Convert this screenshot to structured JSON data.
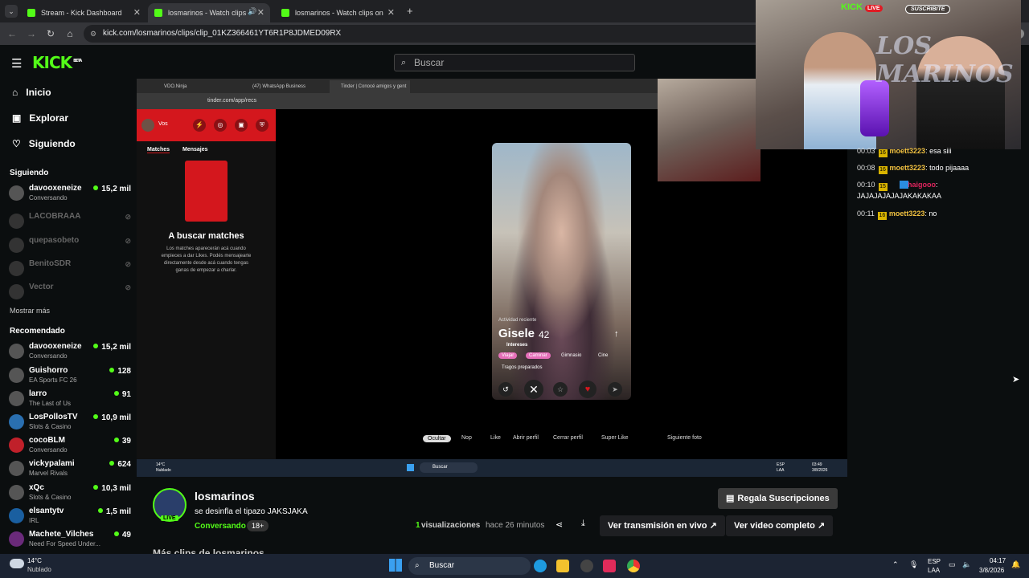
{
  "browser": {
    "tabs": [
      {
        "label": "Stream - Kick Dashboard"
      },
      {
        "label": "losmarinos - Watch clips on"
      },
      {
        "label": "losmarinos - Watch clips on Kic"
      }
    ],
    "url": "kick.com/losmarinos/clips/clip_01KZ366461YT6R1P8JDMED09RX"
  },
  "header": {
    "logo": "KICK",
    "logo_badge": "BETA",
    "search_placeholder": "Buscar"
  },
  "sidebar": {
    "nav": [
      {
        "label": "Inicio",
        "icon": "home-icon"
      },
      {
        "label": "Explorar",
        "icon": "compass-icon"
      },
      {
        "label": "Siguiendo",
        "icon": "heart-icon"
      }
    ],
    "following_title": "Siguiendo",
    "following": [
      {
        "name": "davooxeneize",
        "sub": "Conversando",
        "viewers": "15,2 mil",
        "live": true
      },
      {
        "name": "LACOBRAAA",
        "sub": "",
        "viewers": "",
        "live": false
      },
      {
        "name": "quepasobeto",
        "sub": "",
        "viewers": "",
        "live": false
      },
      {
        "name": "BenitoSDR",
        "sub": "",
        "viewers": "",
        "live": false
      },
      {
        "name": "Vector",
        "sub": "",
        "viewers": "",
        "live": false
      }
    ],
    "show_more": "Mostrar más",
    "recommended_title": "Recomendado",
    "recommended": [
      {
        "name": "davooxeneize",
        "sub": "Conversando",
        "viewers": "15,2 mil"
      },
      {
        "name": "Guishorro",
        "sub": "EA Sports FC 26",
        "viewers": "128"
      },
      {
        "name": "larro",
        "sub": "The Last of Us",
        "viewers": "91"
      },
      {
        "name": "LosPollosTV",
        "sub": "Slots & Casino",
        "viewers": "10,9 mil"
      },
      {
        "name": "cocoBLM",
        "sub": "Conversando",
        "viewers": "39"
      },
      {
        "name": "vickypalami",
        "sub": "Marvel Rivals",
        "viewers": "624"
      },
      {
        "name": "xQc",
        "sub": "Slots & Casino",
        "viewers": "10,3 mil"
      },
      {
        "name": "elsantytv",
        "sub": "IRL",
        "viewers": "1,5 mil"
      },
      {
        "name": "Machete_Vilches",
        "sub": "Need For Speed Under...",
        "viewers": "49"
      }
    ]
  },
  "embedded": {
    "tabs": [
      "VDO.Ninja",
      "(47) WhatsApp Business",
      "Tinder | Conocé amigos y gent"
    ],
    "url": "tinder.com/app/recs",
    "panel": {
      "user": "Vos",
      "tab_matches": "Matches",
      "tab_messages": "Mensajes",
      "empty_title": "A buscar matches",
      "empty_text": "Los matches aparecerán acá cuando empieces a dar Likes. Podés mensajearte directamente desde acá cuando tengas ganas de empezar a charlar."
    },
    "profile": {
      "activity": "Actividad reciente",
      "name": "Gisele",
      "age": "42",
      "interests_title": "Intereses",
      "interests": [
        "Viajar",
        "Caminar",
        "Gimnasio",
        "Cine",
        "Tragos preparados"
      ]
    },
    "hints": [
      "Ocultar",
      "Nop",
      "Like",
      "Abrir perfil",
      "Cerrar perfil",
      "Super Like",
      "Siguiente foto"
    ],
    "taskbar": {
      "weather_temp": "14°C",
      "weather_desc": "Nublado",
      "search": "Buscar",
      "lang": "ESP",
      "region": "LAA",
      "time": "03:49",
      "date": "3/8/2026"
    }
  },
  "overlay": {
    "brand": "KICK",
    "live": "LIVE",
    "subscribe": "SUSCRIBITE",
    "banner": "LOS MARINOS"
  },
  "chat": [
    {
      "time": "00:03",
      "badge": "16",
      "user": "moett3223",
      "text": ": esa siii",
      "color": "#f0c040"
    },
    {
      "time": "00:08",
      "badge": "16",
      "user": "moett3223",
      "text": ": todo pijaaaa",
      "color": "#f0c040"
    },
    {
      "time": "00:10",
      "badge": "15",
      "user": "elhaigooo",
      "text": ":",
      "color": "#e0245e"
    },
    {
      "time": "",
      "badge": "",
      "user": "",
      "text": "JAJAJAJAJAJAKAKAKAA",
      "color": "#fff"
    },
    {
      "time": "00:11",
      "badge": "16",
      "user": "moett3223",
      "text": ": no",
      "color": "#f0c040"
    }
  ],
  "clip": {
    "channel": "losmarinos",
    "live_badge": "LIVE",
    "title": "se desinfla el tipazo JAKSJAKA",
    "category": "Conversando",
    "age_tag": "18+",
    "views_count": "1",
    "views_label": "visualizaciones",
    "time_ago": "hace 26 minutos",
    "gift_button": "Regala Suscripciones",
    "live_button": "Ver transmisión en vivo",
    "full_video_button": "Ver video completo",
    "more_clips": "Más clips de losmarinos"
  },
  "taskbar": {
    "weather_temp": "14°C",
    "weather_desc": "Nublado",
    "search": "Buscar",
    "lang": "ESP",
    "region": "LAA",
    "time": "04:17",
    "date": "3/8/2026"
  },
  "colors": {
    "accent": "#53fc18",
    "tinder": "#d4171d",
    "background": "#0b0e0f"
  }
}
